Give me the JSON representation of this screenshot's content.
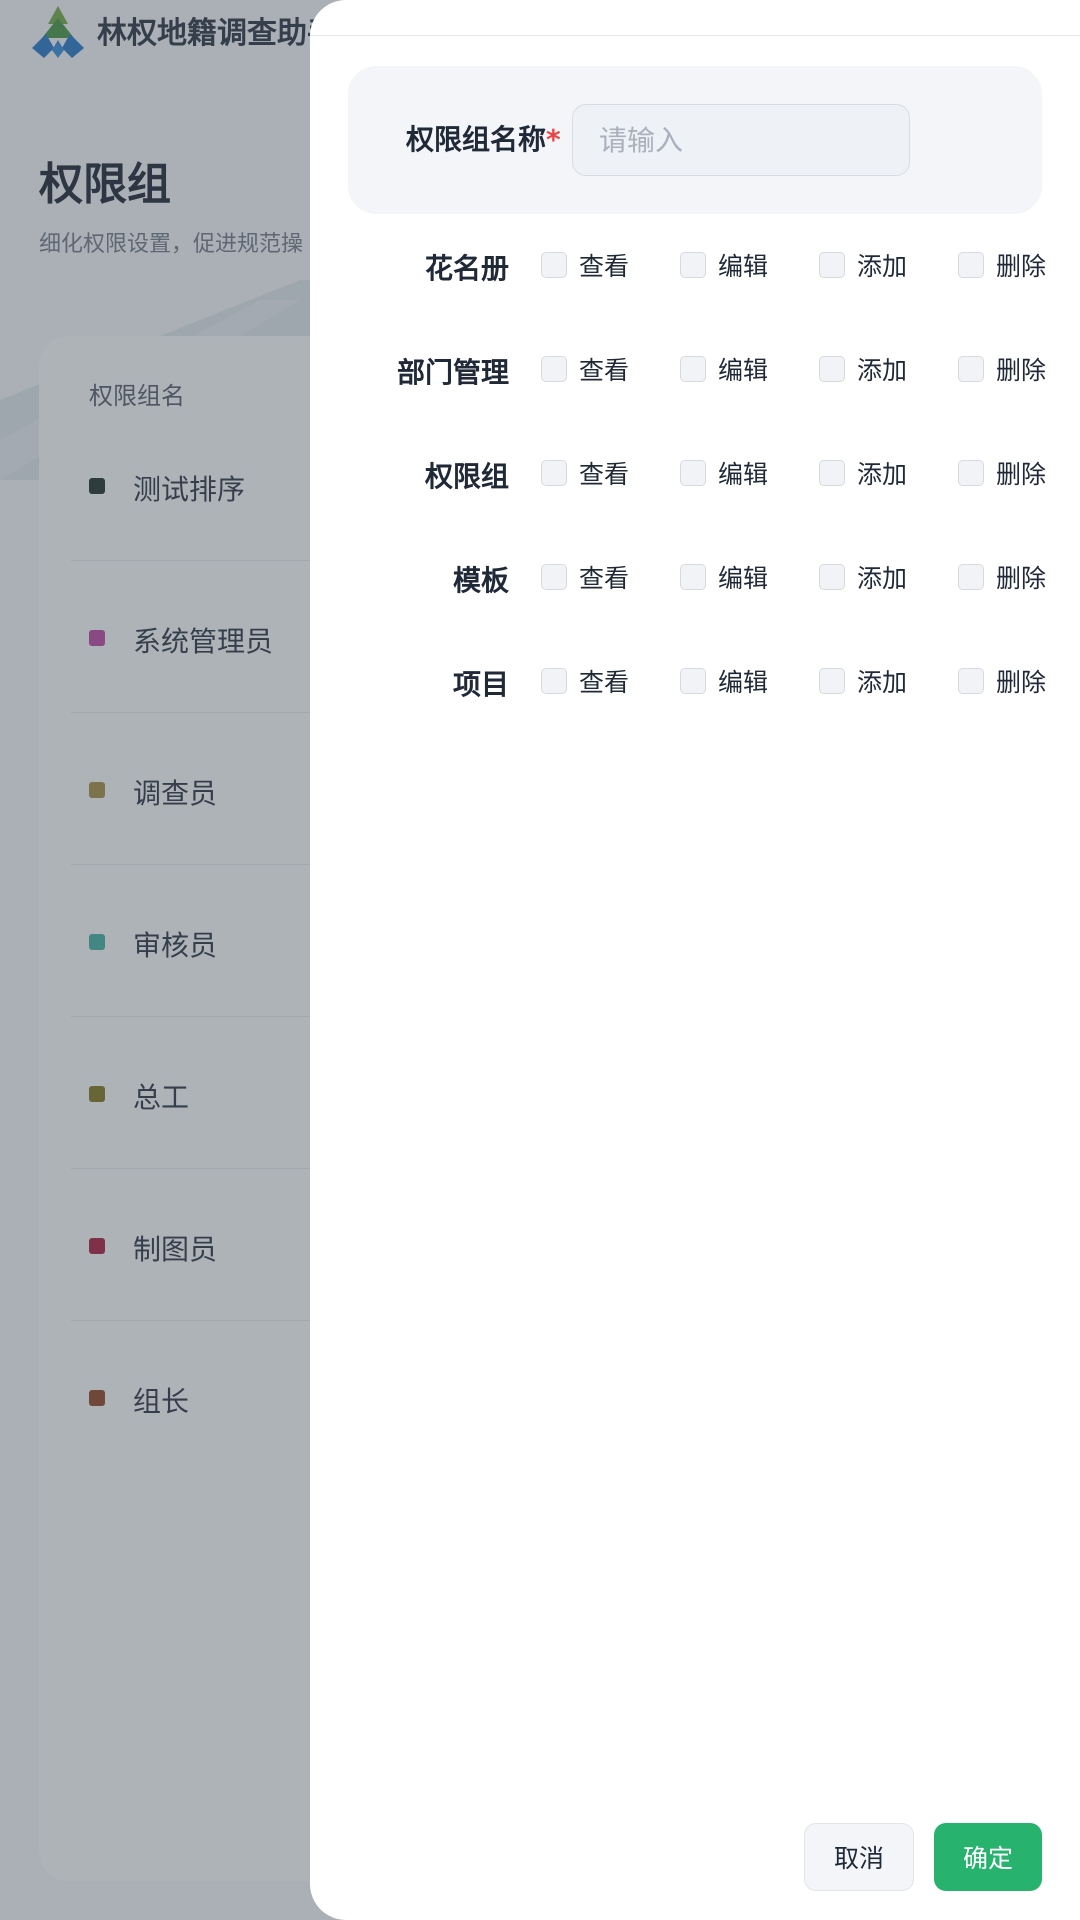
{
  "app": {
    "title": "林权地籍调查助手"
  },
  "page": {
    "title": "权限组",
    "subtitle": "细化权限设置，促进规范操"
  },
  "role_list": {
    "column_header": "权限组名",
    "items": [
      {
        "name": "测试排序",
        "color": "#13231f"
      },
      {
        "name": "系统管理员",
        "color": "#b83c9e"
      },
      {
        "name": "调查员",
        "color": "#a08538"
      },
      {
        "name": "审核员",
        "color": "#3ba99a"
      },
      {
        "name": "总工",
        "color": "#7c6d12"
      },
      {
        "name": "制图员",
        "color": "#a80f36"
      },
      {
        "name": "组长",
        "color": "#8a3a16"
      }
    ]
  },
  "drawer": {
    "name_field": {
      "label": "权限组名称",
      "required_mark": "*",
      "placeholder": "请输入",
      "value": ""
    },
    "permissions": [
      {
        "module": "花名册",
        "options": [
          "查看",
          "编辑",
          "添加",
          "删除"
        ]
      },
      {
        "module": "部门管理",
        "options": [
          "查看",
          "编辑",
          "添加",
          "删除"
        ]
      },
      {
        "module": "权限组",
        "options": [
          "查看",
          "编辑",
          "添加",
          "删除"
        ]
      },
      {
        "module": "模板",
        "options": [
          "查看",
          "编辑",
          "添加",
          "删除"
        ]
      },
      {
        "module": "项目",
        "options": [
          "查看",
          "编辑",
          "添加",
          "删除"
        ]
      }
    ],
    "cancel_label": "取消",
    "confirm_label": "确定"
  },
  "colors": {
    "accent": "#27b26e",
    "required": "#ef4444"
  }
}
